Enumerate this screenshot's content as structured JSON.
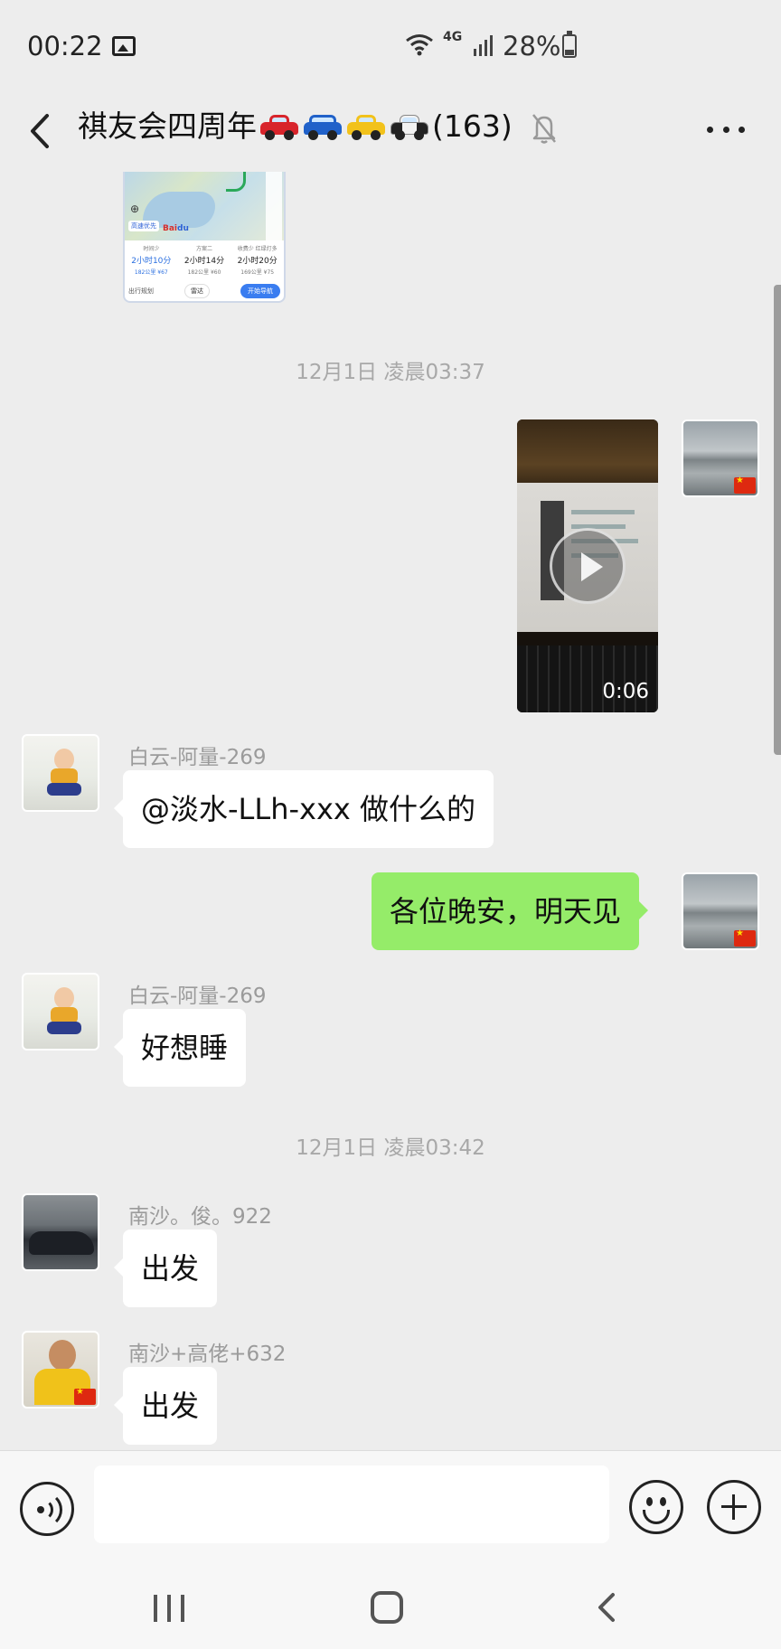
{
  "status_bar": {
    "time": "00:22",
    "network": "4G",
    "battery": "28%",
    "battery_level": 0.28
  },
  "header": {
    "title": "祺友会四周年",
    "title_emoji": [
      "red-car-icon",
      "blue-suv-icon",
      "taxi-icon",
      "police-car-icon"
    ],
    "member_count": "(163)",
    "muted": true
  },
  "map_card": {
    "brand_a": "Bai",
    "brand_b": "du",
    "chip": "高速优先",
    "routes": [
      {
        "name": "时间少",
        "time": "2小时10分",
        "dist": "182公里 ¥67"
      },
      {
        "name": "方案二",
        "time": "2小时14分",
        "dist": "182公里 ¥60"
      },
      {
        "name": "收费少 红绿灯多",
        "time": "2小时20分",
        "dist": "169公里 ¥75"
      }
    ],
    "left_action": "出行规划",
    "mid_action": "雷达",
    "nav_action": "开始导航"
  },
  "messages": {
    "ts1": "12月1日 凌晨03:37",
    "video_duration": "0:06",
    "m1_sender": "白云-阿量-269",
    "m1_text": "@淡水-LLh-xxx  做什么的",
    "m2_text": "各位晚安，明天见",
    "m3_sender": "白云-阿量-269",
    "m3_text": "好想睡",
    "ts2": "12月1日 凌晨03:42",
    "m4_sender": "南沙。俊。922",
    "m4_text": "出发",
    "m5_sender": "南沙+高佬+632",
    "m5_text": "出发"
  },
  "input": {
    "placeholder": ""
  },
  "colors": {
    "background": "#ededed",
    "self_bubble": "#95ec69",
    "other_bubble": "#ffffff",
    "timestamp": "#a8a8a8"
  }
}
